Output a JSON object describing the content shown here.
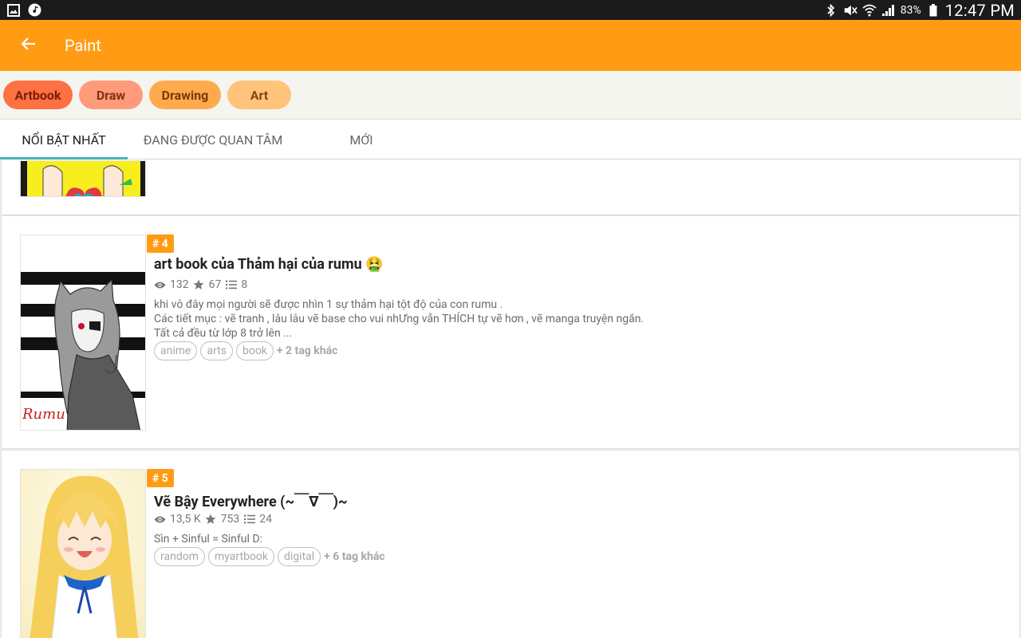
{
  "status_bar": {
    "battery": "83%",
    "time": "12:47 PM",
    "left_icons": [
      "gallery-icon",
      "music-icon"
    ],
    "right_icons": [
      "bluetooth-icon",
      "mute-icon",
      "wifi-icon",
      "signal-icon",
      "battery-icon"
    ]
  },
  "app_bar": {
    "title": "Paint",
    "back_icon": "arrow-left-icon",
    "color": "#ff9c14"
  },
  "chips": [
    {
      "label": "Artbook"
    },
    {
      "label": "Draw"
    },
    {
      "label": "Drawing"
    },
    {
      "label": "Art"
    }
  ],
  "tabs": [
    {
      "label": "NỔI BẬT NHẤT",
      "active": true
    },
    {
      "label": "ĐANG ĐƯỢC QUAN TÂM",
      "active": false
    },
    {
      "label": "MỚI",
      "active": false
    }
  ],
  "stories": [
    {
      "rank": "# 4",
      "title": "art book của Thảm hại của rumu",
      "emoji": "🤮",
      "views": "132",
      "votes": "67",
      "parts": "8",
      "description": [
        "khi vô đây mọi người sẽ được nhìn 1 sự thảm hại tột độ của con rumu .",
        "Các tiết mục : vẽ tranh ,  lâu lâu vẽ base cho vui nhƯng vẫn THÍCH tự vẽ hơn , vẽ manga truyện ngắn.",
        "Tất cả đều từ lớp 8 trở lên ..."
      ],
      "tags": [
        "anime",
        "arts",
        "book"
      ],
      "more_tags": "+ 2 tag khác",
      "cover_signature": "Rumu"
    },
    {
      "rank": "# 5",
      "title": "Vẽ Bậy Everywhere (~￣∇￣)~",
      "views": "13,5 K",
      "votes": "753",
      "parts": "24",
      "description": [
        "Sìn + Sinful = Sinful D:"
      ],
      "tags": [
        "random",
        "myartbook",
        "digital"
      ],
      "more_tags": "+ 6 tag khác"
    }
  ]
}
